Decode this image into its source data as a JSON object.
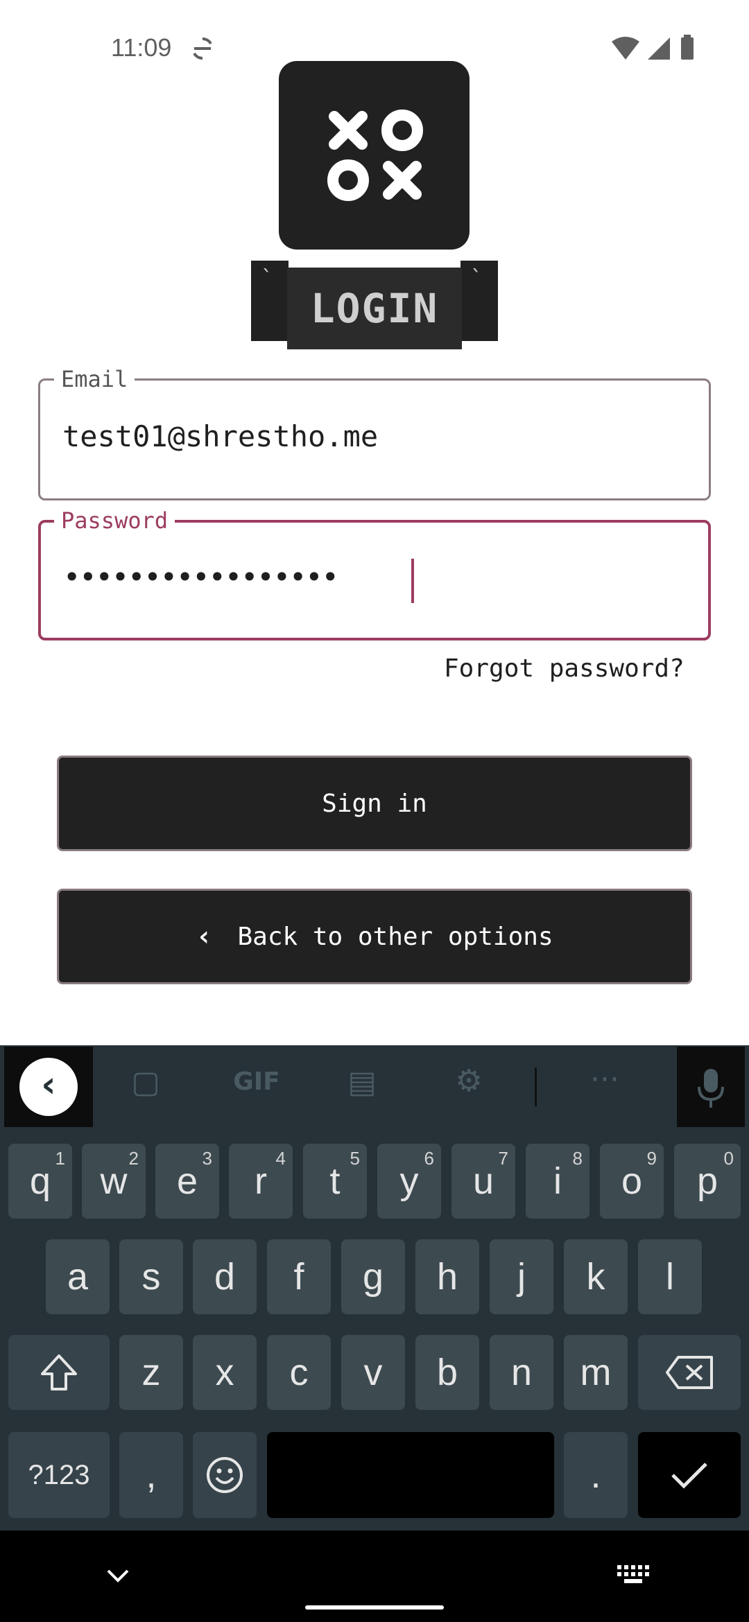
{
  "status": {
    "time": "11:09"
  },
  "banner": {
    "title": "LOGIN"
  },
  "email": {
    "label": "Email",
    "value": "test01@shrestho.me"
  },
  "password": {
    "label": "Password",
    "value": "•••••••••••••••••"
  },
  "forgot_link": "Forgot password?",
  "buttons": {
    "sign_in": "Sign in",
    "back": "Back to other options"
  },
  "keyboard": {
    "toolbar_gif": "GIF",
    "row1": [
      {
        "k": "q",
        "h": "1"
      },
      {
        "k": "w",
        "h": "2"
      },
      {
        "k": "e",
        "h": "3"
      },
      {
        "k": "r",
        "h": "4"
      },
      {
        "k": "t",
        "h": "5"
      },
      {
        "k": "y",
        "h": "6"
      },
      {
        "k": "u",
        "h": "7"
      },
      {
        "k": "i",
        "h": "8"
      },
      {
        "k": "o",
        "h": "9"
      },
      {
        "k": "p",
        "h": "0"
      }
    ],
    "row2": [
      "a",
      "s",
      "d",
      "f",
      "g",
      "h",
      "j",
      "k",
      "l"
    ],
    "row3": [
      "z",
      "x",
      "c",
      "v",
      "b",
      "n",
      "m"
    ],
    "symbols": "?123",
    "comma": ",",
    "period": "."
  },
  "colors": {
    "accent": "#9c3c60",
    "button_bg": "#212121",
    "keyboard_bg": "#263238"
  }
}
